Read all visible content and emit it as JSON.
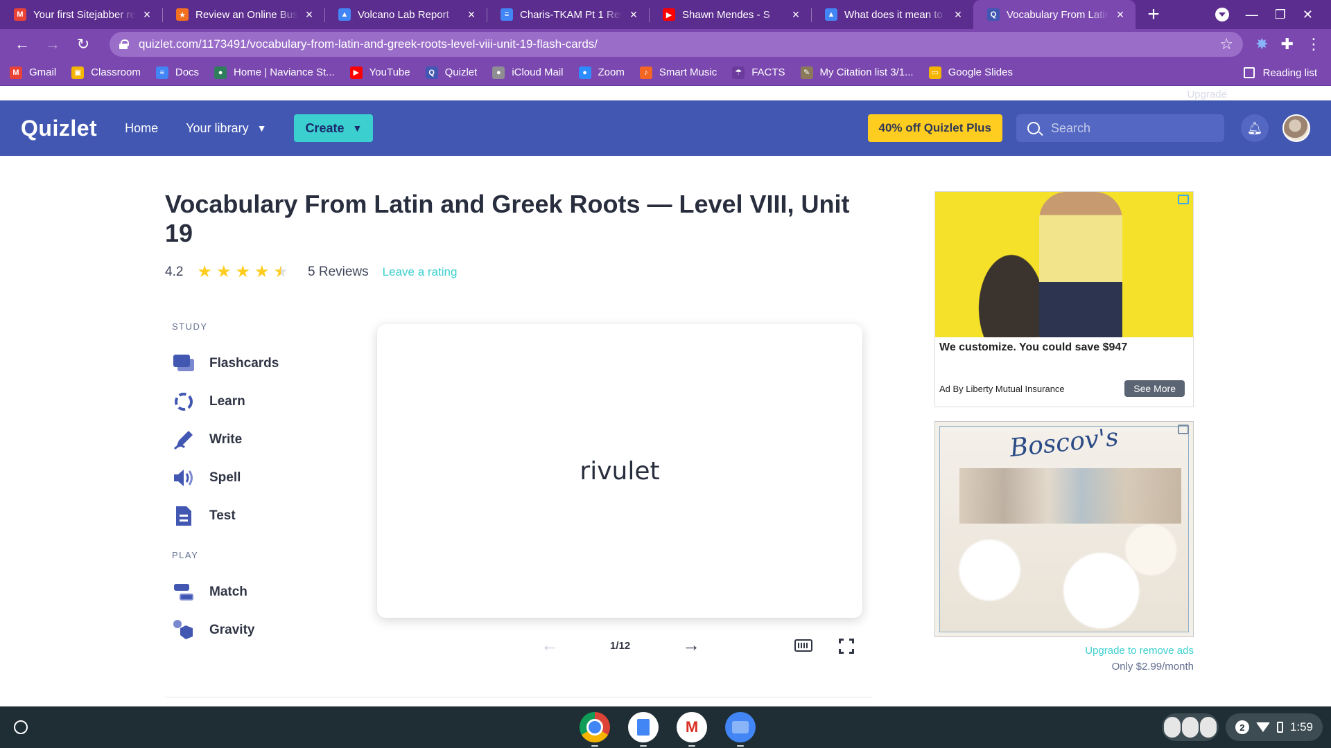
{
  "browser": {
    "tabs": [
      {
        "title": "Your first Sitejabber re",
        "icon": "gmail-icon",
        "color": "#ea4335",
        "glyph": "M"
      },
      {
        "title": "Review an Online Busin",
        "icon": "sitejabber-icon",
        "color": "#f37021",
        "glyph": "★"
      },
      {
        "title": "Volcano Lab Report",
        "icon": "classroom-icon",
        "color": "#4285f4",
        "glyph": "▲"
      },
      {
        "title": "Charis-TKAM Pt 1 Revi",
        "icon": "docs-icon",
        "color": "#4285f4",
        "glyph": "≡"
      },
      {
        "title": "Shawn Mendes - S",
        "icon": "youtube-icon",
        "color": "#ff0000",
        "glyph": "▶"
      },
      {
        "title": "What does it mean to T",
        "icon": "classroom-icon",
        "color": "#4285f4",
        "glyph": "▲"
      },
      {
        "title": "Vocabulary From Latin",
        "icon": "quizlet-icon",
        "color": "#4257b2",
        "glyph": "Q"
      }
    ],
    "new_tab": "+",
    "url": "quizlet.com/1173491/vocabulary-from-latin-and-greek-roots-level-viii-unit-19-flash-cards/",
    "bookmarks": [
      {
        "label": "Gmail",
        "icon": "gmail-icon",
        "color": "#ea4335",
        "glyph": "M"
      },
      {
        "label": "Classroom",
        "icon": "classroom-icon",
        "color": "#f4b400",
        "glyph": "▣"
      },
      {
        "label": "Docs",
        "icon": "docs-icon",
        "color": "#4285f4",
        "glyph": "≡"
      },
      {
        "label": "Home | Naviance St...",
        "icon": "naviance-icon",
        "color": "#2e7d5b",
        "glyph": "●"
      },
      {
        "label": "YouTube",
        "icon": "youtube-icon",
        "color": "#ff0000",
        "glyph": "▶"
      },
      {
        "label": "Quizlet",
        "icon": "quizlet-icon",
        "color": "#4257b2",
        "glyph": "Q"
      },
      {
        "label": "iCloud Mail",
        "icon": "apple-icon",
        "color": "#8e8e93",
        "glyph": "●"
      },
      {
        "label": "Zoom",
        "icon": "zoom-icon",
        "color": "#2d8cff",
        "glyph": "●"
      },
      {
        "label": "Smart Music",
        "icon": "smartmusic-icon",
        "color": "#f26522",
        "glyph": "♪"
      },
      {
        "label": "FACTS",
        "icon": "facts-icon",
        "color": "#6a3a9d",
        "glyph": "☂"
      },
      {
        "label": "My Citation list 3/1...",
        "icon": "citation-icon",
        "color": "#8a7a5a",
        "glyph": "✎"
      },
      {
        "label": "Google Slides",
        "icon": "slides-icon",
        "color": "#f4b400",
        "glyph": "▭"
      }
    ],
    "reading_list": "Reading list"
  },
  "quizlet": {
    "logo": "Quizlet",
    "nav": {
      "home": "Home",
      "library": "Your library",
      "create": "Create"
    },
    "promo": "40% off Quizlet Plus",
    "search_placeholder": "Search",
    "upgrade_ghost": "Upgrade",
    "brand_color": "#4257b2",
    "accent_color": "#3ccfcf"
  },
  "set": {
    "title": "Vocabulary From Latin and Greek Roots — Level VIII, Unit 19",
    "rating": "4.2",
    "rating_value": 4.5,
    "reviews": "5 Reviews",
    "leave_rating": "Leave a rating"
  },
  "study": {
    "study_label": "STUDY",
    "study_modes": [
      {
        "label": "Flashcards",
        "icon": "flashcards-icon"
      },
      {
        "label": "Learn",
        "icon": "learn-icon"
      },
      {
        "label": "Write",
        "icon": "write-icon"
      },
      {
        "label": "Spell",
        "icon": "spell-icon"
      },
      {
        "label": "Test",
        "icon": "test-icon"
      }
    ],
    "play_label": "PLAY",
    "play_modes": [
      {
        "label": "Match",
        "icon": "match-icon"
      },
      {
        "label": "Gravity",
        "icon": "gravity-icon"
      }
    ]
  },
  "flashcard": {
    "term": "rivulet",
    "counter": "1/12"
  },
  "ads": {
    "ad1_headline": "We customize. You could save $947",
    "ad1_advertiser": "Ad By Liberty Mutual Insurance",
    "ad1_cta": "See More",
    "ad2_brand": "Boscov's",
    "upgrade_link": "Upgrade to remove ads",
    "upgrade_price": "Only $2.99/month"
  },
  "system": {
    "notification_count": "2",
    "time": "1:59"
  }
}
